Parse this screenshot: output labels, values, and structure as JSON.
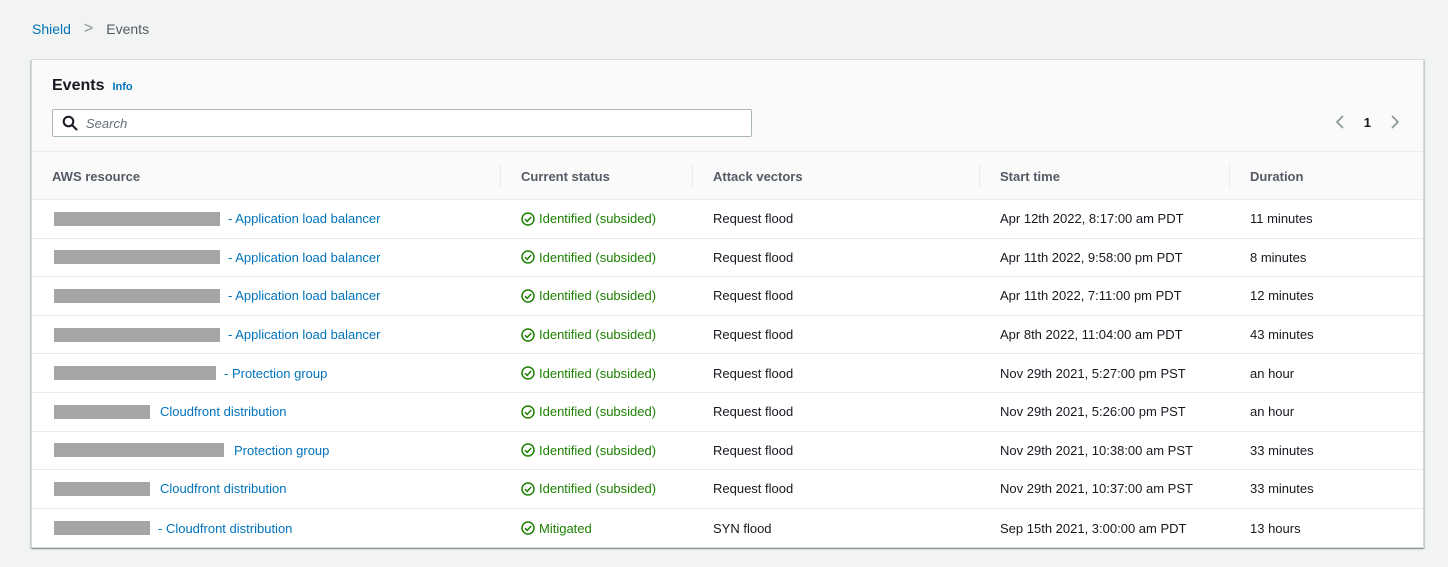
{
  "breadcrumb": {
    "root": "Shield",
    "current": "Events"
  },
  "panel": {
    "title": "Events",
    "info": "Info"
  },
  "search": {
    "placeholder": "Search",
    "value": ""
  },
  "pagination": {
    "current_page": "1"
  },
  "columns": [
    "AWS resource",
    "Current status",
    "Attack vectors",
    "Start time",
    "Duration"
  ],
  "colors": {
    "link": "#0073bb",
    "success": "#1d8102",
    "redaction": "#a5a5a5"
  },
  "rows": [
    {
      "resource": "- Application load balancer",
      "status": "Identified (subsided)",
      "vector": "Request flood",
      "start": "Apr 12th 2022, 8:17:00 am PDT",
      "duration": "11 minutes"
    },
    {
      "resource": "- Application load balancer",
      "status": "Identified (subsided)",
      "vector": "Request flood",
      "start": "Apr 11th 2022, 9:58:00 pm PDT",
      "duration": "8 minutes"
    },
    {
      "resource": "- Application load balancer",
      "status": "Identified (subsided)",
      "vector": "Request flood",
      "start": "Apr 11th 2022, 7:11:00 pm PDT",
      "duration": "12 minutes"
    },
    {
      "resource": "- Application load balancer",
      "status": "Identified (subsided)",
      "vector": "Request flood",
      "start": "Apr 8th 2022, 11:04:00 am PDT",
      "duration": "43 minutes"
    },
    {
      "resource": "- Protection group",
      "status": "Identified (subsided)",
      "vector": "Request flood",
      "start": "Nov 29th 2021, 5:27:00 pm PST",
      "duration": "an hour"
    },
    {
      "resource": "Cloudfront distribution",
      "status": "Identified (subsided)",
      "vector": "Request flood",
      "start": "Nov 29th 2021, 5:26:00 pm PST",
      "duration": "an hour"
    },
    {
      "resource": "Protection group",
      "status": "Identified (subsided)",
      "vector": "Request flood",
      "start": "Nov 29th 2021, 10:38:00 am PST",
      "duration": "33 minutes"
    },
    {
      "resource": "Cloudfront distribution",
      "status": "Identified (subsided)",
      "vector": "Request flood",
      "start": "Nov 29th 2021, 10:37:00 am PST",
      "duration": "33 minutes"
    },
    {
      "resource": "- Cloudfront distribution",
      "status": "Mitigated",
      "vector": "SYN flood",
      "start": "Sep 15th 2021, 3:00:00 am PDT",
      "duration": "13 hours"
    }
  ]
}
